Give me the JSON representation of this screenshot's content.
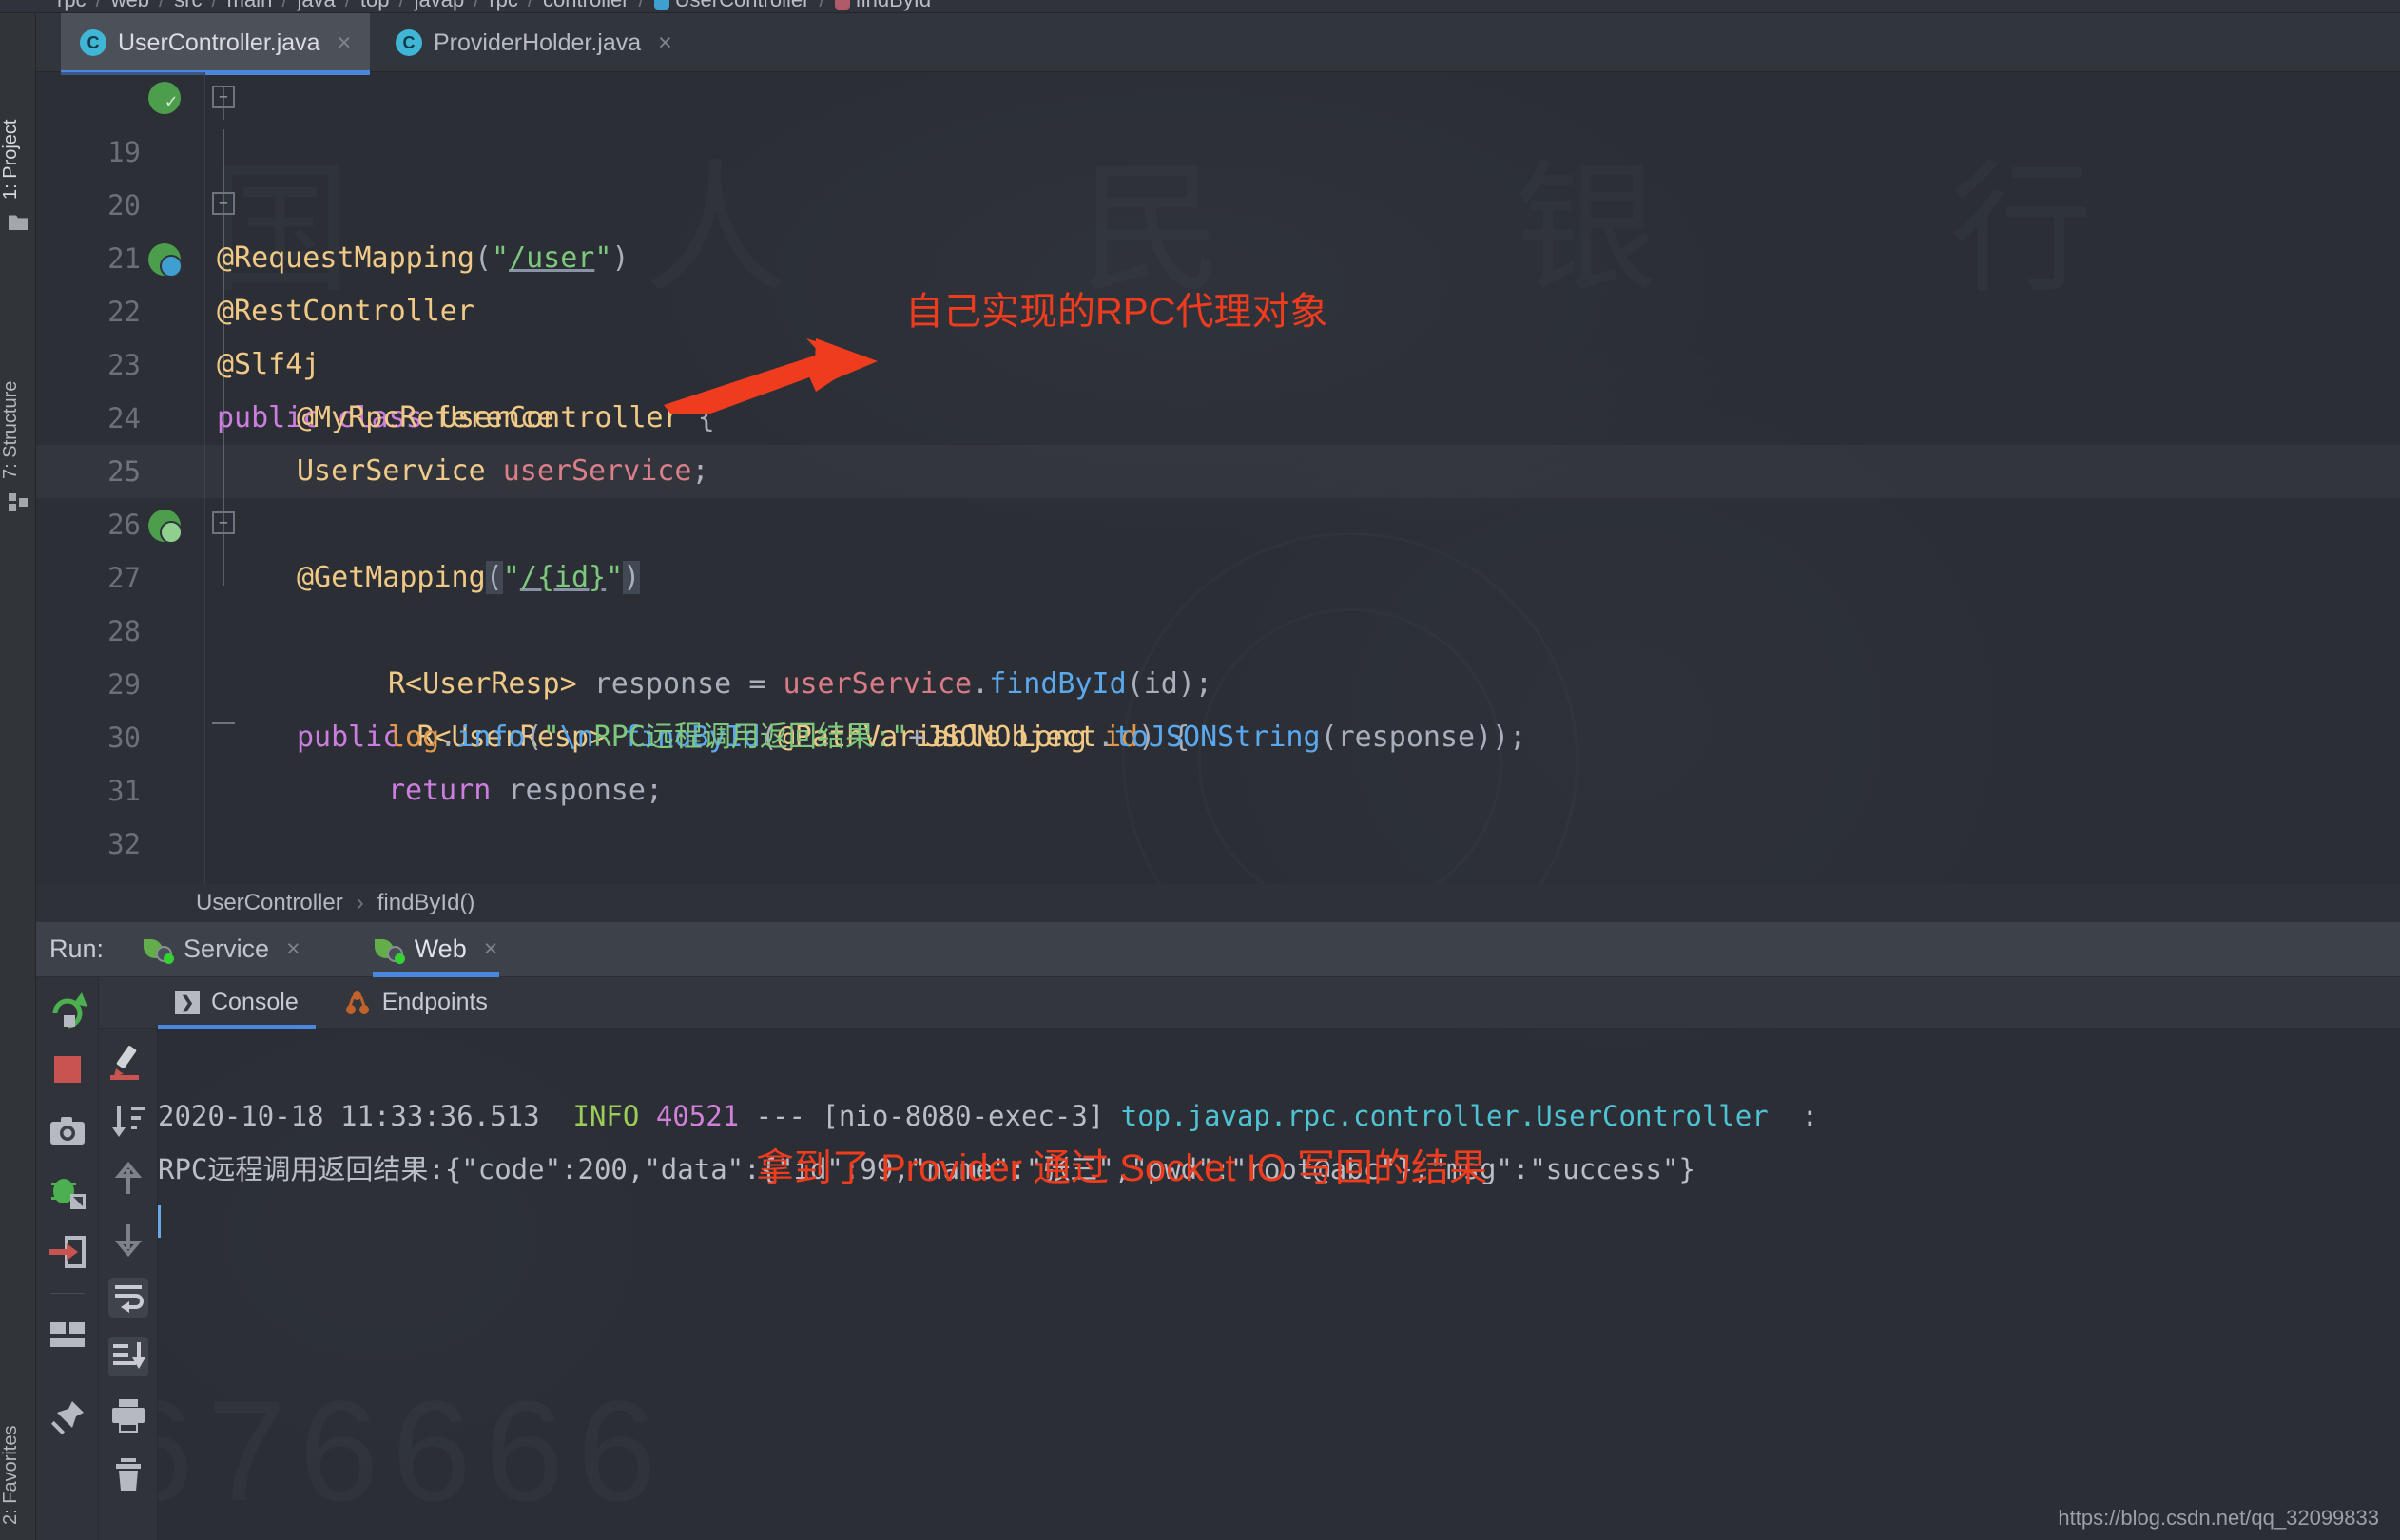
{
  "breadcrumb": {
    "items": [
      "rpc",
      "web",
      "src",
      "main",
      "java",
      "top",
      "javap",
      "rpc",
      "controller",
      "UserController",
      "findById"
    ]
  },
  "left_tool_window": {
    "project_label": "1: Project",
    "structure_label": "7: Structure",
    "favorites_label": "2: Favorites"
  },
  "editor_tabs": [
    {
      "label": "UserController.java",
      "icon": "class-icon",
      "close": "×",
      "active": true
    },
    {
      "label": "ProviderHolder.java",
      "icon": "class-icon",
      "close": "×",
      "active": false
    }
  ],
  "code": {
    "lines": [
      {
        "num": "19",
        "marker": "run-check-icon",
        "fold": "minus"
      },
      {
        "num": "20",
        "marker": "",
        "fold": ""
      },
      {
        "num": "21",
        "marker": "",
        "fold": "minus"
      },
      {
        "num": "22",
        "marker": "run-class-icon",
        "fold": ""
      },
      {
        "num": "23",
        "marker": "",
        "fold": ""
      },
      {
        "num": "24",
        "marker": "",
        "fold": ""
      },
      {
        "num": "25",
        "marker": "",
        "fold": ""
      },
      {
        "num": "26",
        "marker": "",
        "fold": ""
      },
      {
        "num": "27",
        "marker": "run-globe-icon",
        "fold": "minus"
      },
      {
        "num": "28",
        "marker": "",
        "fold": ""
      },
      {
        "num": "29",
        "marker": "",
        "fold": ""
      },
      {
        "num": "30",
        "marker": "",
        "fold": ""
      },
      {
        "num": "31",
        "marker": "",
        "fold": "end"
      },
      {
        "num": "32",
        "marker": "",
        "fold": ""
      }
    ],
    "text": {
      "l19_annotation": "@RestController",
      "l20_annotation": "@RequestMapping",
      "l20_string": "/user",
      "l21_annotation": "@Slf4j",
      "l22_kw1": "public",
      "l22_kw2": "class",
      "l22_name": "UserController",
      "l22_brace": "{",
      "l23_annotation": "@MyRpcReference",
      "l24_type": "UserService",
      "l24_field": "userService",
      "l26_annotation": "@GetMapping",
      "l26_string": "/{id}",
      "l27_kw": "public",
      "l27_type": "R<UserResp>",
      "l27_method": "findById",
      "l27_param_ann": "@PathVariable",
      "l27_param_type": "Long",
      "l27_param_name": "id",
      "l28_type": "R<UserResp>",
      "l28_var": "response",
      "l28_target": "userService",
      "l28_call": "findById",
      "l28_arg": "id",
      "l29_log": "log",
      "l29_info": "info",
      "l29_esc": "\\n",
      "l29_msg": "RPC远程调用返回结果:",
      "l29_json": "JSONObject",
      "l29_tostring": "toJSONString",
      "l29_arg": "response",
      "l30_return": "return",
      "l30_var": "response",
      "l31_brace": "}",
      "l32_brace": "}"
    }
  },
  "editor_breadcrumb": {
    "class": "UserController",
    "separator": "›",
    "method": "findById()"
  },
  "run_window": {
    "label": "Run:",
    "tabs": [
      {
        "label": "Service",
        "icon": "spring-boot-icon",
        "close": "×",
        "active": false
      },
      {
        "label": "Web",
        "icon": "spring-boot-icon",
        "close": "×",
        "active": true
      }
    ],
    "sub_tabs": [
      {
        "label": "Console",
        "icon": "console-icon",
        "active": true
      },
      {
        "label": "Endpoints",
        "icon": "endpoints-icon",
        "active": false
      }
    ],
    "toolbar_left": [
      "rerun-icon",
      "stop-icon",
      "screenshot-icon",
      "debug-icon",
      "exit-icon",
      "layout-icon",
      "pin-icon"
    ],
    "toolbar_right": [
      "highlight-icon",
      "sort-icon",
      "up-icon",
      "down-icon",
      "soft-wrap-icon",
      "scroll-to-end-icon",
      "print-icon",
      "clear-all-icon"
    ]
  },
  "console": {
    "line1": {
      "timestamp": "2020-10-18 11:33:36.513",
      "level": "INFO",
      "pid": "40521",
      "dashes": "---",
      "thread": "[nio-8080-exec-3]",
      "logger": "top.javap.rpc.controller.UserController",
      "colon": ":"
    },
    "line2": "RPC远程调用返回结果:{\"code\":200,\"data\":{\"id\":99,\"name\":\"张三\",\"pwd\":\"root@abc\"},\"msg\":\"success\"}"
  },
  "annotations": [
    {
      "id": "rpc-proxy-note",
      "text": "自己实现的RPC代理对象",
      "color": "#f03c1e"
    },
    {
      "id": "socket-io-note",
      "text": "拿到了 Provider 通过 Socket IO 写回的结果",
      "color": "#f03c1e"
    }
  ],
  "watermarks": {
    "number": "676666",
    "chinese": "国    人    民    银    行",
    "url": "https://blog.csdn.net/qq_32099833"
  },
  "colors": {
    "accent": "#4a88e0",
    "annotation_red": "#f03c1e",
    "editor_bg": "#2b2e35",
    "panel_bg": "#31353c"
  }
}
